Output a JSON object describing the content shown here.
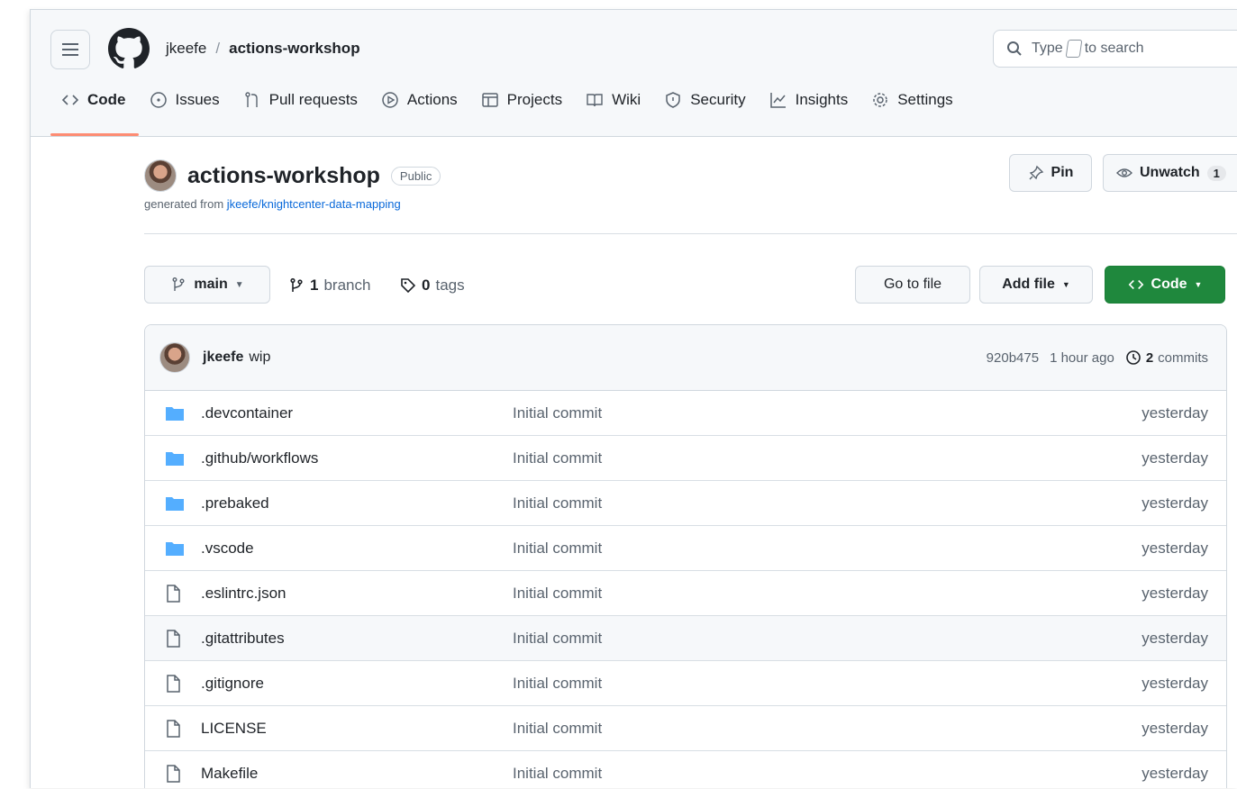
{
  "header": {
    "owner": "jkeefe",
    "separator": "/",
    "repo": "actions-workshop",
    "search_placeholder_before": "Type",
    "search_placeholder_after": "to search"
  },
  "tabs": [
    {
      "label": "Code",
      "icon": "code-icon"
    },
    {
      "label": "Issues",
      "icon": "issue-icon"
    },
    {
      "label": "Pull requests",
      "icon": "pull-request-icon"
    },
    {
      "label": "Actions",
      "icon": "play-icon"
    },
    {
      "label": "Projects",
      "icon": "table-icon"
    },
    {
      "label": "Wiki",
      "icon": "book-icon"
    },
    {
      "label": "Security",
      "icon": "shield-icon"
    },
    {
      "label": "Insights",
      "icon": "graph-icon"
    },
    {
      "label": "Settings",
      "icon": "gear-icon"
    }
  ],
  "repo": {
    "name": "actions-workshop",
    "visibility": "Public",
    "generated_prefix": "generated from",
    "generated_link": "jkeefe/knightcenter-data-mapping",
    "pin_label": "Pin",
    "watch_label": "Unwatch",
    "watch_count": "1"
  },
  "toolbar": {
    "branch": "main",
    "branch_count": "1",
    "branch_word": "branch",
    "tag_count": "0",
    "tag_word": "tags",
    "goto_file": "Go to file",
    "add_file": "Add file",
    "code_button": "Code"
  },
  "latest_commit": {
    "user": "jkeefe",
    "message": "wip",
    "sha": "920b475",
    "time": "1 hour ago",
    "commit_count": "2",
    "commit_word": "commits"
  },
  "files": [
    {
      "name": ".devcontainer",
      "type": "dir",
      "message": "Initial commit",
      "date": "yesterday"
    },
    {
      "name": ".github/workflows",
      "type": "dir",
      "message": "Initial commit",
      "date": "yesterday"
    },
    {
      "name": ".prebaked",
      "type": "dir",
      "message": "Initial commit",
      "date": "yesterday"
    },
    {
      "name": ".vscode",
      "type": "dir",
      "message": "Initial commit",
      "date": "yesterday"
    },
    {
      "name": ".eslintrc.json",
      "type": "file",
      "message": "Initial commit",
      "date": "yesterday"
    },
    {
      "name": ".gitattributes",
      "type": "file",
      "message": "Initial commit",
      "date": "yesterday"
    },
    {
      "name": ".gitignore",
      "type": "file",
      "message": "Initial commit",
      "date": "yesterday"
    },
    {
      "name": "LICENSE",
      "type": "file",
      "message": "Initial commit",
      "date": "yesterday"
    },
    {
      "name": "Makefile",
      "type": "file",
      "message": "Initial commit",
      "date": "yesterday"
    }
  ],
  "colors": {
    "accent_green": "#1f883d",
    "link_blue": "#0969da",
    "folder_blue": "#54aeff",
    "tab_underline": "#fd8c73"
  }
}
